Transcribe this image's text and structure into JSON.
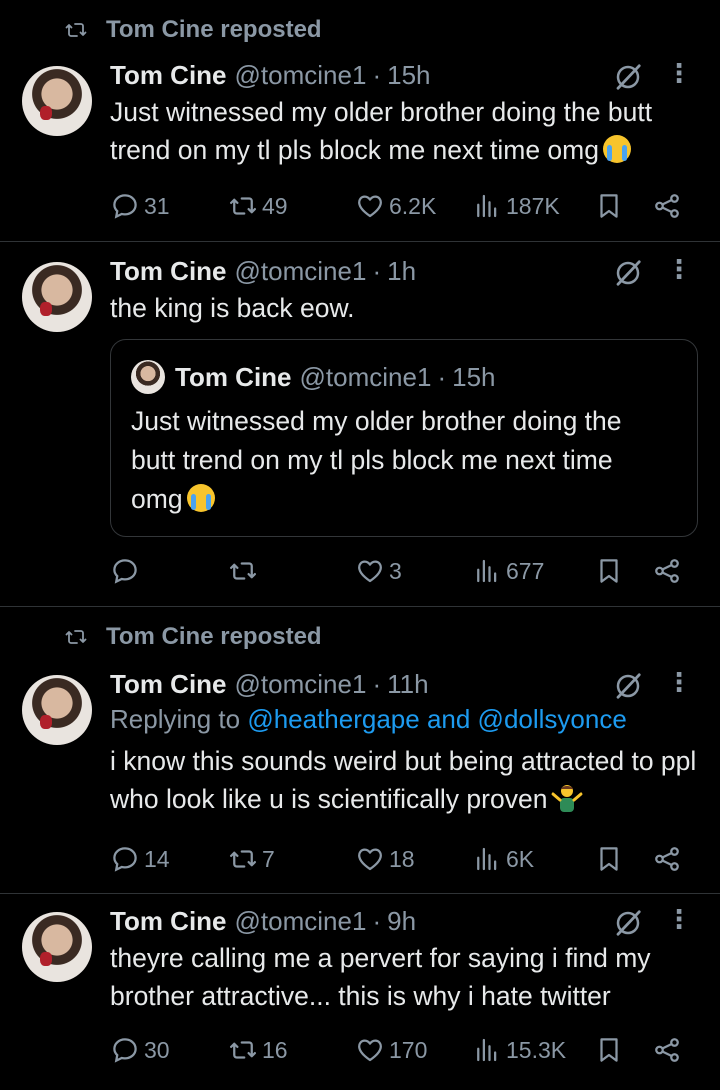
{
  "posts": [
    {
      "repost_label": "Tom Cine reposted",
      "name": "Tom Cine",
      "handle": "@tomcine1",
      "time": "15h",
      "text": "Just witnessed my older brother doing the butt trend on my tl pls block me next time omg",
      "emoji": "loudly-crying-face",
      "stats": {
        "replies": "31",
        "reposts": "49",
        "likes": "6.2K",
        "views": "187K"
      }
    },
    {
      "name": "Tom Cine",
      "handle": "@tomcine1",
      "time": "1h",
      "text": "the king is back eow.",
      "quote": {
        "name": "Tom Cine",
        "handle": "@tomcine1",
        "time": "15h",
        "text": "Just witnessed my older brother doing the butt trend on my tl pls block me next time omg",
        "emoji": "loudly-crying-face"
      },
      "stats": {
        "replies": "",
        "reposts": "",
        "likes": "3",
        "views": "677"
      }
    },
    {
      "repost_label": "Tom Cine reposted",
      "name": "Tom Cine",
      "handle": "@tomcine1",
      "time": "11h",
      "replying_prefix": "Replying to",
      "replying_users": "@heathergape and @dollsyonce",
      "text": "i know this sounds weird but being attracted to ppl who look like u is scientifically proven",
      "emoji": "person-shrugging",
      "stats": {
        "replies": "14",
        "reposts": "7",
        "likes": "18",
        "views": "6K"
      }
    },
    {
      "name": "Tom Cine",
      "handle": "@tomcine1",
      "time": "9h",
      "text": "theyre calling me a pervert for saying i find my brother attractive... this is why i hate twitter",
      "stats": {
        "replies": "30",
        "reposts": "16",
        "likes": "170",
        "views": "15.3K"
      }
    }
  ],
  "colors": {
    "background": "#000000",
    "text": "#e7e9ea",
    "muted": "#8b98a5",
    "link": "#1d9bf0",
    "divider": "#2f3336"
  },
  "icons": [
    "repost-icon",
    "grok-icon",
    "more-icon",
    "reply-icon",
    "like-icon",
    "views-icon",
    "bookmark-icon",
    "share-icon"
  ],
  "dot": "·",
  "more": "⋮"
}
